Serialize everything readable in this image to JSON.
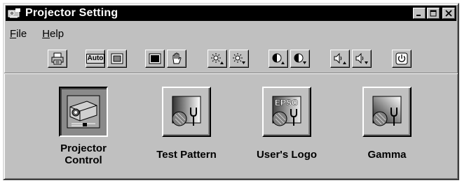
{
  "window": {
    "title": "Projector Setting",
    "caption_buttons": [
      "minimize",
      "maximize",
      "close"
    ]
  },
  "menu": {
    "file": {
      "underlined": "F",
      "rest": "ile"
    },
    "help": {
      "underlined": "H",
      "rest": "elp"
    }
  },
  "toolbar": {
    "auto_label": "Auto",
    "buttons": [
      "printer-icon",
      "auto-button",
      "screen-icon",
      "black-screen-icon",
      "hand-icon",
      "brightness-up-icon",
      "brightness-down-icon",
      "contrast-up-icon",
      "contrast-down-icon",
      "volume-up-icon",
      "volume-down-icon",
      "power-icon"
    ]
  },
  "tiles": [
    {
      "line1": "Projector",
      "line2": "Control",
      "selected": true,
      "icon": "projector-icon"
    },
    {
      "line1": "Test Pattern",
      "line2": "",
      "selected": false,
      "icon": "test-pattern-icon"
    },
    {
      "line1": "User's Logo",
      "line2": "",
      "selected": false,
      "icon": "users-logo-icon",
      "icon_text": "EPSO"
    },
    {
      "line1": "Gamma",
      "line2": "",
      "selected": false,
      "icon": "gamma-icon"
    }
  ],
  "colors": {
    "titlebar": "#000000",
    "face": "#c0c0c0",
    "pressed": "#8a8a8a"
  }
}
